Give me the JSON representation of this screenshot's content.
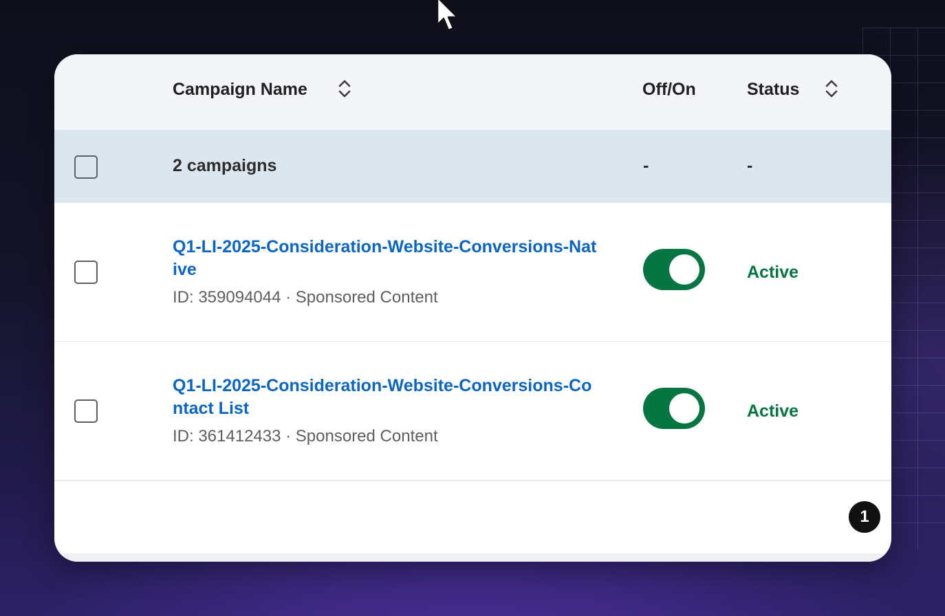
{
  "table": {
    "headers": {
      "campaign_name": "Campaign Name",
      "off_on": "Off/On",
      "status": "Status"
    },
    "summary": {
      "label": "2 campaigns",
      "off_on": "-",
      "status": "-"
    },
    "rows": [
      {
        "name": "Q1-LI-2025-Consideration-Website-Conversions-Native",
        "meta": "ID: 359094044 · Sponsored Content",
        "enabled": true,
        "status": "Active"
      },
      {
        "name": "Q1-LI-2025-Consideration-Website-Conversions-Contact List",
        "meta": "ID: 361412433 · Sponsored Content",
        "enabled": true,
        "status": "Active"
      }
    ]
  },
  "pagination": {
    "current_page": "1"
  },
  "colors": {
    "link": "#0a66c2",
    "active": "#057642",
    "header_bg": "#f3f5f8",
    "summary_bg": "#dce6ee"
  },
  "icons": {
    "sort": "sort-icon",
    "cursor": "mouse-pointer-icon",
    "toggle": "toggle-switch"
  }
}
